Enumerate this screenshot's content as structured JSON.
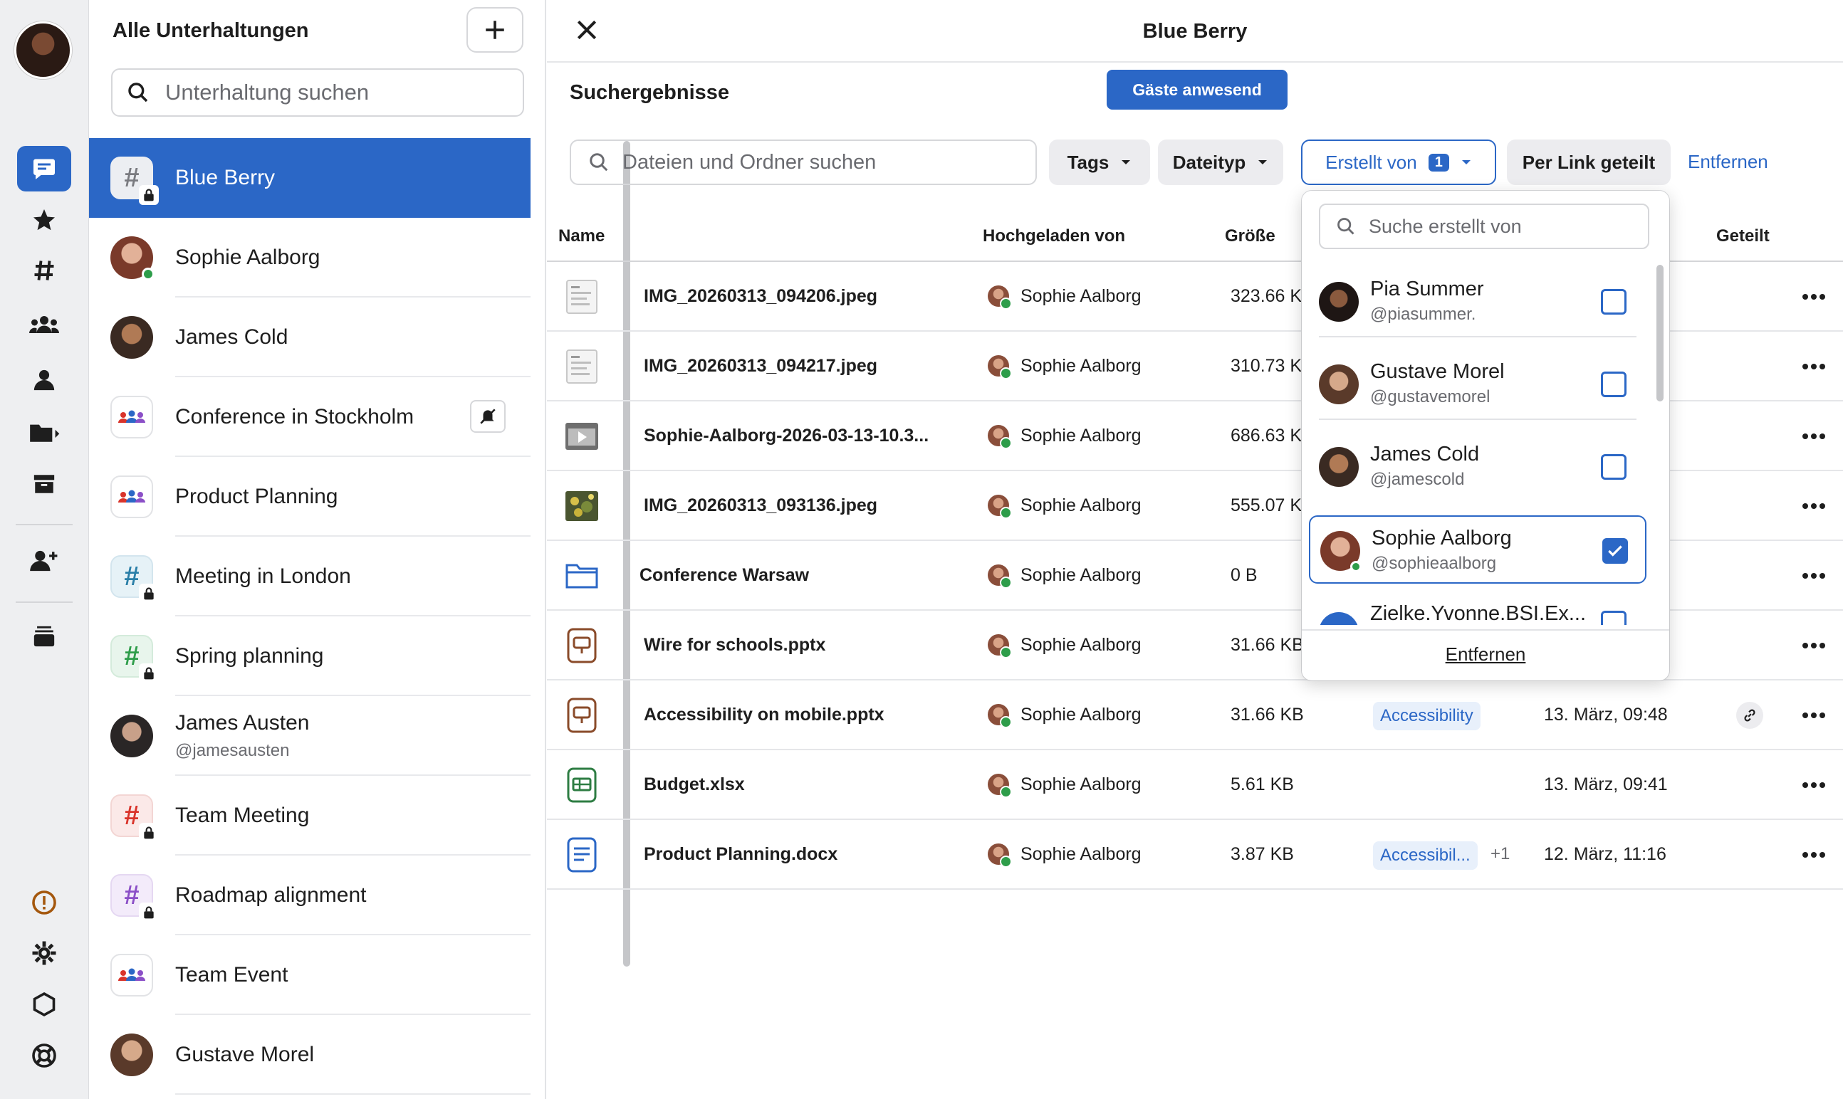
{
  "sidebar_rail": {
    "items": [
      "chat-icon",
      "star-icon",
      "hash-icon",
      "groups-icon",
      "person-icon",
      "folder-forward-icon",
      "archive-icon",
      "add-person-icon",
      "stack-icon"
    ],
    "bottom": [
      "info-icon",
      "gear-icon",
      "hexagon-icon",
      "lifebuoy-icon"
    ]
  },
  "conversations": {
    "title": "Alle Unterhaltungen",
    "search_placeholder": "Unterhaltung suchen",
    "items": [
      {
        "name": "Blue Berry",
        "type": "channel-locked",
        "selected": true
      },
      {
        "name": "Sophie Aalborg",
        "type": "person",
        "online": true
      },
      {
        "name": "James Cold",
        "type": "person"
      },
      {
        "name": "Conference in Stockholm",
        "type": "group",
        "muted": true
      },
      {
        "name": "Product Planning",
        "type": "group"
      },
      {
        "name": "Meeting in London",
        "type": "channel-locked",
        "color": "#2a7fa8"
      },
      {
        "name": "Spring planning",
        "type": "channel-locked",
        "color": "#2e9d4a"
      },
      {
        "name": "James Austen",
        "handle": "@jamesausten",
        "type": "person"
      },
      {
        "name": "Team Meeting",
        "type": "channel-locked",
        "color": "#d9342b"
      },
      {
        "name": "Roadmap alignment",
        "type": "channel-locked",
        "color": "#8b4fc7"
      },
      {
        "name": "Team Event",
        "type": "group"
      },
      {
        "name": "Gustave Morel",
        "type": "person"
      }
    ]
  },
  "main": {
    "title": "Blue Berry",
    "section_title": "Suchergebnisse",
    "guest_banner": "Gäste anwesend",
    "file_search_placeholder": "Dateien und Ordner suchen",
    "filters": {
      "tags": "Tags",
      "filetype": "Dateityp",
      "created_by": "Erstellt von",
      "created_by_count": "1",
      "shared_by_link": "Per Link geteilt",
      "remove": "Entfernen"
    },
    "columns": {
      "name": "Name",
      "uploaded_by": "Hochgeladen von",
      "size": "Größe",
      "shared": "Geteilt"
    },
    "files": [
      {
        "name": "IMG_20260313_094206.jpeg",
        "icon": "image-doc-icon",
        "uploader": "Sophie Aalborg",
        "size": "323.66 K"
      },
      {
        "name": "IMG_20260313_094217.jpeg",
        "icon": "image-doc-icon",
        "uploader": "Sophie Aalborg",
        "size": "310.73 K"
      },
      {
        "name": "Sophie-Aalborg-2026-03-13-10.3...",
        "icon": "video-icon",
        "uploader": "Sophie Aalborg",
        "size": "686.63 K"
      },
      {
        "name": "IMG_20260313_093136.jpeg",
        "icon": "photo-icon",
        "uploader": "Sophie Aalborg",
        "size": "555.07 K"
      },
      {
        "name": "Conference Warsaw",
        "icon": "folder-icon",
        "uploader": "Sophie Aalborg",
        "size": "0 B"
      },
      {
        "name": "Wire for schools.pptx",
        "icon": "presentation-icon",
        "uploader": "Sophie Aalborg",
        "size": "31.66 KB"
      },
      {
        "name": "Accessibility on mobile.pptx",
        "icon": "presentation-icon",
        "uploader": "Sophie Aalborg",
        "size": "31.66 KB",
        "tag": "Accessibility",
        "date": "13. März, 09:48",
        "shared_link": true
      },
      {
        "name": "Budget.xlsx",
        "icon": "spreadsheet-icon",
        "uploader": "Sophie Aalborg",
        "size": "5.61 KB",
        "date": "13. März, 09:41"
      },
      {
        "name": "Product Planning.docx",
        "icon": "document-icon",
        "uploader": "Sophie Aalborg",
        "size": "3.87 KB",
        "tag": "Accessibil...",
        "tag_more": "+1",
        "date": "12. März, 11:16"
      }
    ]
  },
  "dropdown": {
    "search_placeholder": "Suche erstellt von",
    "users": [
      {
        "name": "Pia Summer",
        "handle": "@piasummer.",
        "checked": false
      },
      {
        "name": "Gustave Morel",
        "handle": "@gustavemorel",
        "checked": false
      },
      {
        "name": "James Cold",
        "handle": "@jamescold",
        "checked": false
      },
      {
        "name": "Sophie Aalborg",
        "handle": "@sophieaalborg",
        "checked": true
      },
      {
        "name": "Zielke.Yvonne.BSI.Ex...",
        "handle": "",
        "checked": false
      }
    ],
    "remove": "Entfernen"
  },
  "colors": {
    "accent": "#2b67c6",
    "online": "#2e9d4a",
    "rail_bg": "#eeeff1"
  }
}
